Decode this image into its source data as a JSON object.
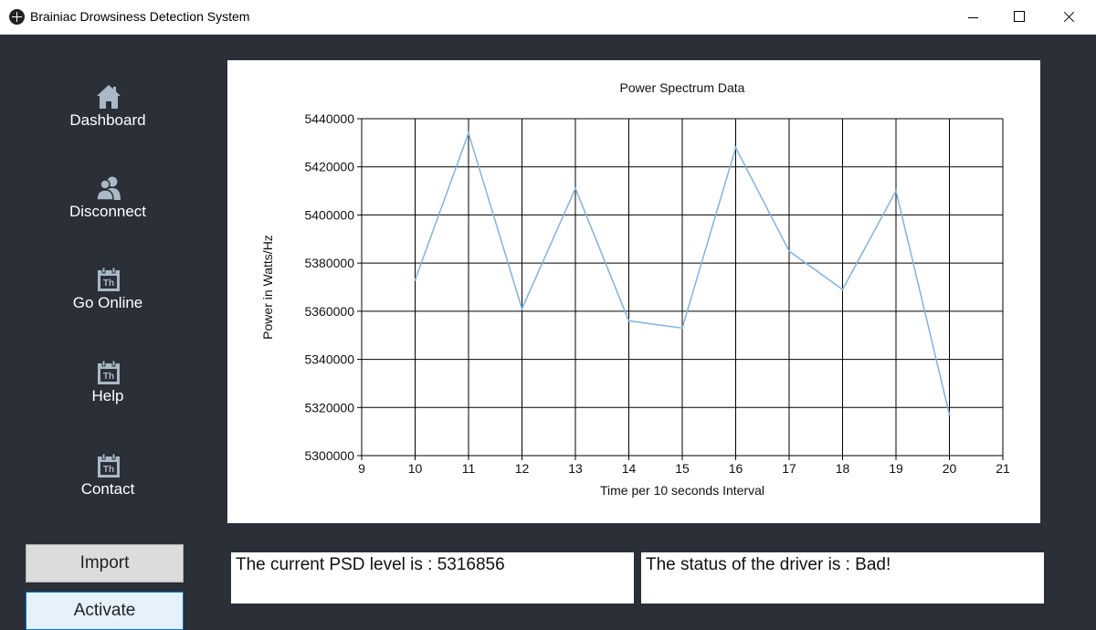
{
  "window": {
    "title": "Brainiac Drowsiness Detection System"
  },
  "sidebar": {
    "items": [
      {
        "label": "Dashboard",
        "icon": "home-icon"
      },
      {
        "label": "Disconnect",
        "icon": "users-icon"
      },
      {
        "label": "Go Online",
        "icon": "calendar-icon",
        "icon_text": "Th"
      },
      {
        "label": "Help",
        "icon": "calendar-icon",
        "icon_text": "Th"
      },
      {
        "label": "Contact",
        "icon": "calendar-icon",
        "icon_text": "Th"
      }
    ],
    "import_label": "Import",
    "activate_label": "Activate"
  },
  "status": {
    "psd_text": "The current PSD level is : 5316856",
    "driver_text": "The status of the driver is : Bad!"
  },
  "colors": {
    "background": "#2b2f38",
    "line": "#7fb2e5",
    "icon": "#a9b9c6"
  },
  "chart_data": {
    "type": "line",
    "title": "Power Spectrum Data",
    "xlabel": "Time per 10 seconds Interval",
    "ylabel": "Power in Watts/Hz",
    "xlim": [
      9,
      21
    ],
    "ylim": [
      5300000,
      5440000
    ],
    "xticks": [
      9,
      10,
      11,
      12,
      13,
      14,
      15,
      16,
      17,
      18,
      19,
      20,
      21
    ],
    "yticks": [
      5300000,
      5320000,
      5340000,
      5360000,
      5380000,
      5400000,
      5420000,
      5440000
    ],
    "grid": true,
    "series": [
      {
        "x": [
          10,
          11,
          12,
          13,
          14,
          15,
          16,
          17,
          18,
          19,
          20
        ],
        "y": [
          5373000,
          5434000,
          5361000,
          5411000,
          5356000,
          5353000,
          5428000,
          5385000,
          5369000,
          5410000,
          5317000
        ]
      }
    ]
  }
}
